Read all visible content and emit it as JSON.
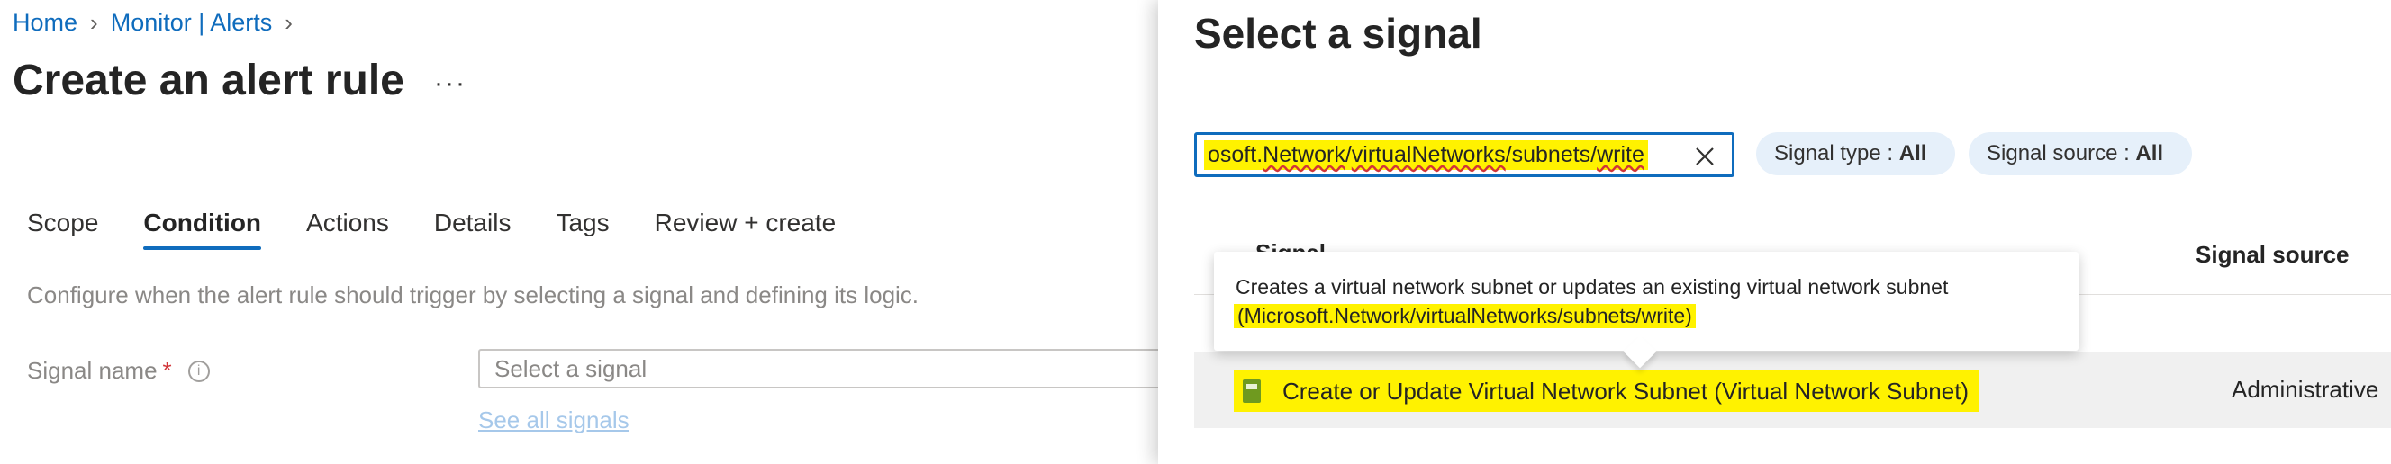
{
  "breadcrumb": {
    "home": "Home",
    "monitor": "Monitor | Alerts"
  },
  "page": {
    "title": "Create an alert rule",
    "more": "···",
    "tabs": [
      "Scope",
      "Condition",
      "Actions",
      "Details",
      "Tags",
      "Review + create"
    ],
    "active_tab": "Condition",
    "description": "Configure when the alert rule should trigger by selecting a signal and defining its logic.",
    "signal_name_label": "Signal name",
    "required_mark": "*",
    "signal_placeholder": "Select a signal",
    "see_all_signals": "See all signals"
  },
  "panel": {
    "title": "Select a signal",
    "search": {
      "prefix": "osoft.",
      "segment1": "Network",
      "sep1": "/",
      "segment2": "virtualNetworks",
      "rest": "/subnets/",
      "segment3": "write"
    },
    "filters": {
      "signal_type_label": "Signal type : ",
      "signal_type_value": "All",
      "signal_source_label": "Signal source : ",
      "signal_source_value": "All"
    },
    "columns": {
      "signal_partial": "Signal",
      "signal_source": "Signal source"
    },
    "rows": [
      {
        "name": "Create or Update Virtual Network Subnet (Virtual Network Subnet)",
        "source": "Administrative"
      }
    ],
    "tooltip": {
      "line1": "Creates a virtual network subnet or updates an existing virtual network subnet",
      "line2": "(Microsoft.Network/virtualNetworks/subnets/write)"
    }
  },
  "colors": {
    "accent": "#0f6cbd",
    "highlight": "#fff200",
    "pill_bg": "#e6f0fa"
  }
}
